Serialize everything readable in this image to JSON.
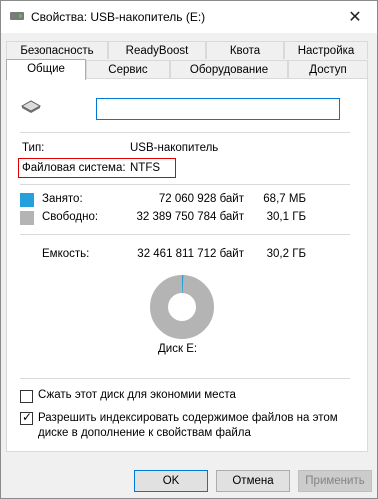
{
  "window": {
    "title": "Свойства: USB-накопитель (E:)"
  },
  "tabs": {
    "row1": [
      "Безопасность",
      "ReadyBoost",
      "Квота",
      "Настройка"
    ],
    "row2": [
      "Общие",
      "Сервис",
      "Оборудование",
      "Доступ"
    ]
  },
  "general": {
    "volume_name": "",
    "type_label": "Тип:",
    "type_value": "USB-накопитель",
    "fs_label": "Файловая система:",
    "fs_value": "NTFS",
    "used_label": "Занято:",
    "used_bytes": "72 060 928 байт",
    "used_short": "68,7 МБ",
    "free_label": "Свободно:",
    "free_bytes": "32 389 750 784 байт",
    "free_short": "30,1 ГБ",
    "capacity_label": "Емкость:",
    "capacity_bytes": "32 461 811 712 байт",
    "capacity_short": "30,2 ГБ",
    "disk_label": "Диск E:",
    "used_fraction": 0.0022,
    "compress_label": "Сжать этот диск для экономии места",
    "compress_checked": false,
    "index_label": "Разрешить индексировать содержимое файлов на этом диске в дополнение к свойствам файла",
    "index_checked": true
  },
  "colors": {
    "used": "#26a0da",
    "free": "#b4b4b4",
    "highlight": "#e00000"
  },
  "buttons": {
    "ok": "OK",
    "cancel": "Отмена",
    "apply": "Применить"
  }
}
